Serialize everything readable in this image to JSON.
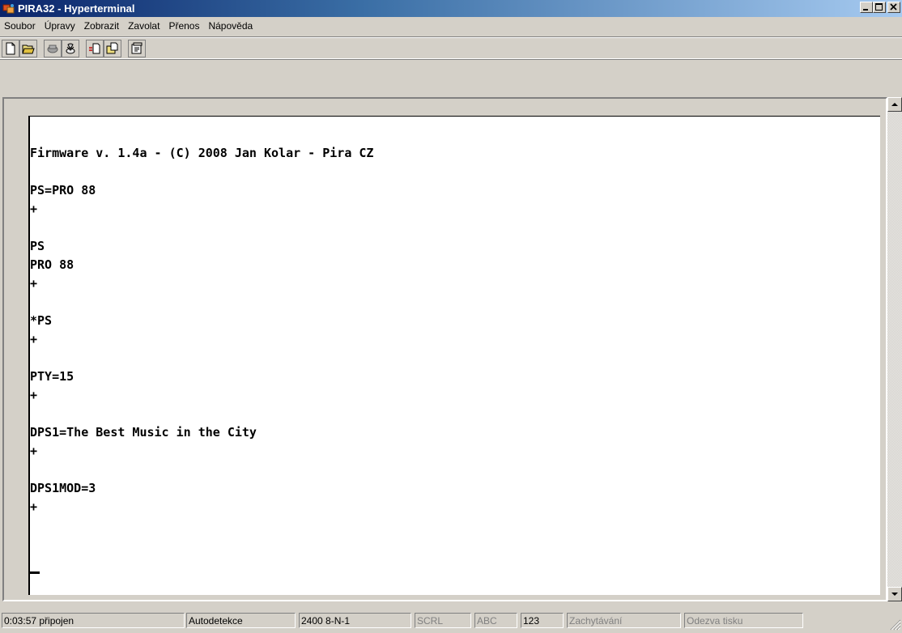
{
  "window": {
    "title": "PIRA32 - Hyperterminal"
  },
  "menu": {
    "items": [
      {
        "label": "Soubor"
      },
      {
        "label": "Úpravy"
      },
      {
        "label": "Zobrazit"
      },
      {
        "label": "Zavolat"
      },
      {
        "label": "Přenos"
      },
      {
        "label": "Nápověda"
      }
    ]
  },
  "toolbar": {
    "buttons": [
      {
        "icon": "new-icon",
        "title": "New"
      },
      {
        "icon": "open-icon",
        "title": "Open"
      },
      {
        "icon": "connect-icon",
        "title": "Connect"
      },
      {
        "icon": "disconnect-icon",
        "title": "Disconnect"
      },
      {
        "icon": "send-icon",
        "title": "Send"
      },
      {
        "icon": "receive-icon",
        "title": "Receive"
      },
      {
        "icon": "properties-icon",
        "title": "Properties"
      }
    ]
  },
  "terminal": {
    "lines": [
      "Firmware v. 1.4a - (C) 2008 Jan Kolar - Pira CZ",
      "",
      "PS=PRO 88",
      "+",
      "",
      "PS",
      "PRO 88",
      "+",
      "",
      "*PS",
      "+",
      "",
      "PTY=15",
      "+",
      "",
      "DPS1=The Best Music in the City",
      "+",
      "",
      "DPS1MOD=3",
      "+"
    ]
  },
  "status": {
    "time": "0:03:57 připojen",
    "detect": "Autodetekce",
    "port": "2400 8-N-1",
    "scrl": "SCRL",
    "abc": "ABC",
    "num": "123",
    "capture": "Zachytávání",
    "print_echo": "Odezva tisku"
  }
}
